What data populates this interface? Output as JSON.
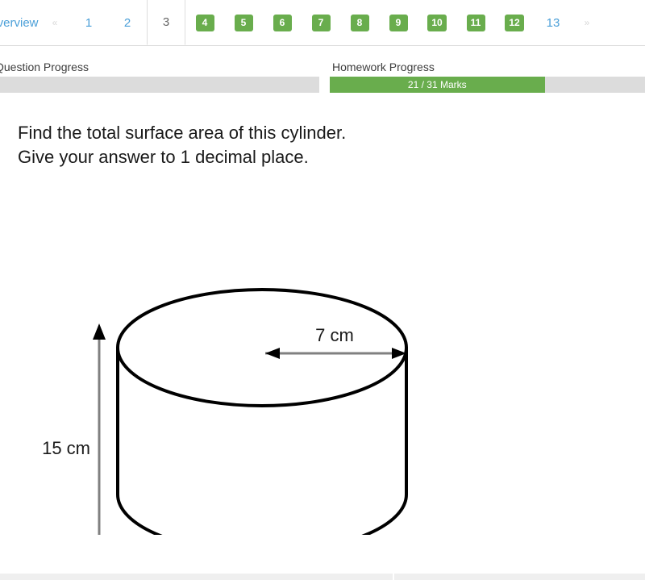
{
  "topbar": {
    "strip_color": "#69717d",
    "accent_color": "#c5d3e2"
  },
  "tabs": {
    "overview_label": "Overview",
    "prev_arrow": "«",
    "next_arrow": "»",
    "active_index": 3,
    "items": [
      {
        "label": "1",
        "state": "unanswered"
      },
      {
        "label": "2",
        "state": "unanswered"
      },
      {
        "label": "3",
        "state": "active"
      },
      {
        "label": "4",
        "state": "correct"
      },
      {
        "label": "5",
        "state": "correct"
      },
      {
        "label": "6",
        "state": "correct"
      },
      {
        "label": "7",
        "state": "correct"
      },
      {
        "label": "8",
        "state": "correct"
      },
      {
        "label": "9",
        "state": "correct"
      },
      {
        "label": "10",
        "state": "correct"
      },
      {
        "label": "11",
        "state": "correct"
      },
      {
        "label": "12",
        "state": "correct"
      },
      {
        "label": "13",
        "state": "unanswered"
      }
    ],
    "link_color": "#4a9fd8",
    "badge_color": "#69ad4d"
  },
  "progress": {
    "question": {
      "label": "Question Progress",
      "value_text": "0",
      "percent": 0
    },
    "homework": {
      "label": "Homework Progress",
      "value_text": "21 / 31 Marks",
      "marks_earned": 21,
      "marks_total": 31,
      "percent": 68
    },
    "fill_color": "#69ad4d",
    "track_color": "#dcdcdc"
  },
  "question": {
    "line1": "Find the total surface area of this cylinder.",
    "line2": "Give your answer to 1 decimal place."
  },
  "figure": {
    "shape": "cylinder",
    "radius_label": "7 cm",
    "height_label": "15 cm",
    "stroke_color": "#000000",
    "dimension_color": "#808080"
  }
}
